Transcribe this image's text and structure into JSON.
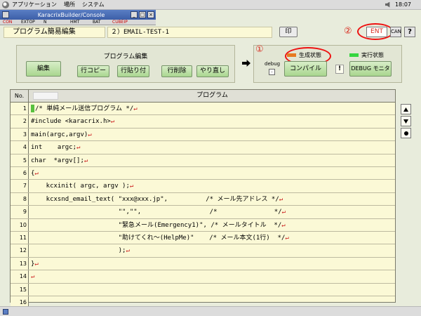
{
  "sysbar": {
    "menus": [
      "アプリケーション",
      "場所",
      "システム"
    ],
    "clock": "18:07"
  },
  "window": {
    "title": "KaracrixBuilder/Console",
    "min_label": "_",
    "max_label": "□",
    "close_label": "×"
  },
  "strip": {
    "items": [
      "CON",
      "EXTOP",
      "N",
      "HMT",
      "BAT",
      "CUBEIP"
    ]
  },
  "header": {
    "program_title": "プログラム簡易編集",
    "program_name": "２）EMAIL-TEST-1",
    "print_label": "印",
    "ent_label": "ENT",
    "can_label": "CAN",
    "help_label": "?",
    "marker_2": "②"
  },
  "edit_panel": {
    "caption": "プログラム編集",
    "edit_label": "編集",
    "copy_label": "行コピー",
    "paste_label": "行貼り付",
    "delete_label": "行削除",
    "redo_label": "やり直し"
  },
  "compile_panel": {
    "marker_1": "①",
    "state_generated": "生成状態",
    "state_running": "実行状態",
    "debug_label": "debug",
    "compile_label": "コンパイル",
    "warn_label": "!",
    "monitor_label": "DEBUG モニタ",
    "colors": {
      "generated": "#e77b21",
      "running": "#35d640"
    }
  },
  "table": {
    "col_no": "No.",
    "col_program": "プログラム",
    "return_mark": "↵",
    "rows": [
      {
        "no": "1",
        "code": "/* 単純メール送信プログラム */",
        "ret": true
      },
      {
        "no": "2",
        "code": "#include <karacrix.h>",
        "ret": true
      },
      {
        "no": "3",
        "code": "main(argc,argv)",
        "ret": true
      },
      {
        "no": "4",
        "code": "int    argc;",
        "ret": true
      },
      {
        "no": "5",
        "code": "char  *argv[];",
        "ret": true
      },
      {
        "no": "6",
        "code": "{",
        "ret": true
      },
      {
        "no": "7",
        "code": "    kcxinit( argc, argv );",
        "ret": true
      },
      {
        "no": "8",
        "code": "    kcxsnd_email_text( \"xxx@xxx.jp\",          /* メール先アドレス */",
        "ret": true
      },
      {
        "no": "9",
        "code": "                       \"\",\"\",                  /*               */",
        "ret": true
      },
      {
        "no": "10",
        "code": "                       \"緊急メール(Emergency1)\", /* メールタイトル  */",
        "ret": true
      },
      {
        "no": "11",
        "code": "                       \"助けてくれ～(HelpMe)\"    /* メール本文(1行)  */",
        "ret": true
      },
      {
        "no": "12",
        "code": "                       );",
        "ret": true
      },
      {
        "no": "13",
        "code": "}",
        "ret": true
      },
      {
        "no": "14",
        "code": "",
        "ret": true
      },
      {
        "no": "15",
        "code": "",
        "ret": false
      },
      {
        "no": "16",
        "code": "",
        "ret": false
      }
    ]
  }
}
